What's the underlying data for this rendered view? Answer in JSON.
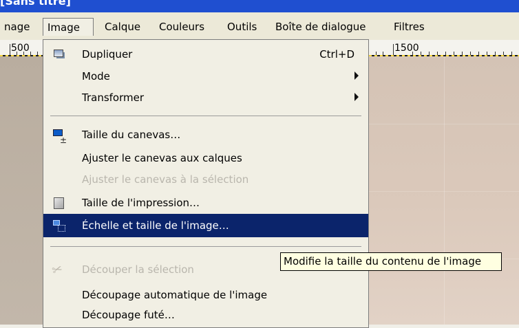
{
  "window": {
    "title_fragment": "[Sans titre]"
  },
  "menubar": {
    "items": [
      {
        "label": "nage"
      },
      {
        "label": "Image"
      },
      {
        "label": "Calque"
      },
      {
        "label": "Couleurs"
      },
      {
        "label": "Outils"
      },
      {
        "label": "Boîte de dialogue"
      },
      {
        "label": "Filtres"
      }
    ]
  },
  "ruler": {
    "labels": [
      "500",
      "1500"
    ]
  },
  "image_menu": {
    "items": [
      {
        "label": "Dupliquer",
        "shortcut": "Ctrl+D",
        "icon": "duplicate-icon"
      },
      {
        "label": "Mode",
        "submenu": true
      },
      {
        "label": "Transformer",
        "submenu": true
      },
      {
        "label": "Taille du canevas…",
        "icon": "canvas-size-icon"
      },
      {
        "label": "Ajuster le canevas aux calques"
      },
      {
        "label": "Ajuster le canevas à la sélection",
        "disabled": true
      },
      {
        "label": "Taille de l'impression…",
        "icon": "print-size-icon"
      },
      {
        "label": "Échelle et taille de l'image…",
        "icon": "scale-image-icon",
        "highlighted": true
      },
      {
        "label": "Découper la sélection",
        "icon": "crop-selection-icon",
        "disabled": true
      },
      {
        "label": "Découpage automatique de l'image"
      },
      {
        "label": "Découpage futé…"
      }
    ]
  },
  "tooltip": {
    "text": "Modifie la taille du contenu de l'image"
  },
  "colors": {
    "highlight": "#0b246b",
    "menu_bg": "#f1efe4",
    "tooltip_bg": "#ffffe1"
  }
}
